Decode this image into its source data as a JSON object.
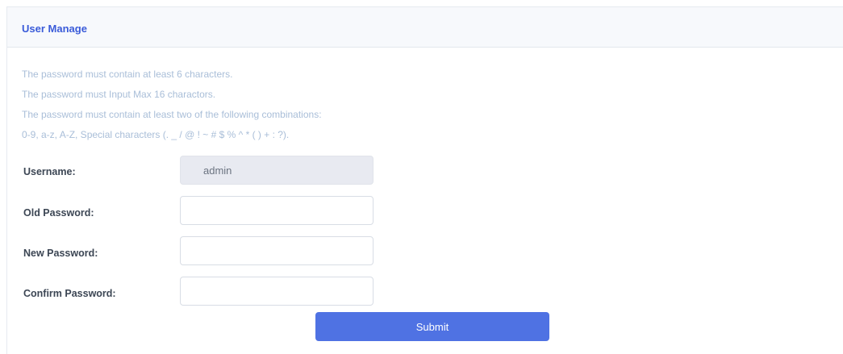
{
  "panel": {
    "title": "User Manage"
  },
  "hints": [
    "The password must contain at least 6 characters.",
    "The password must Input Max 16 charactors.",
    "The password must contain at least two of the following combinations:",
    "0-9, a-z, A-Z, Special characters (. _ / @ ! ~ # $ % ^ * ( ) + : ?)."
  ],
  "form": {
    "username": {
      "label": "Username:",
      "value": "admin"
    },
    "old_password": {
      "label": "Old Password:",
      "value": ""
    },
    "new_password": {
      "label": "New Password:",
      "value": ""
    },
    "confirm_password": {
      "label": "Confirm Password:",
      "value": ""
    },
    "submit_label": "Submit"
  },
  "colors": {
    "accent": "#4f72e3",
    "title": "#3a5bd9",
    "hint": "#a9bed8"
  }
}
